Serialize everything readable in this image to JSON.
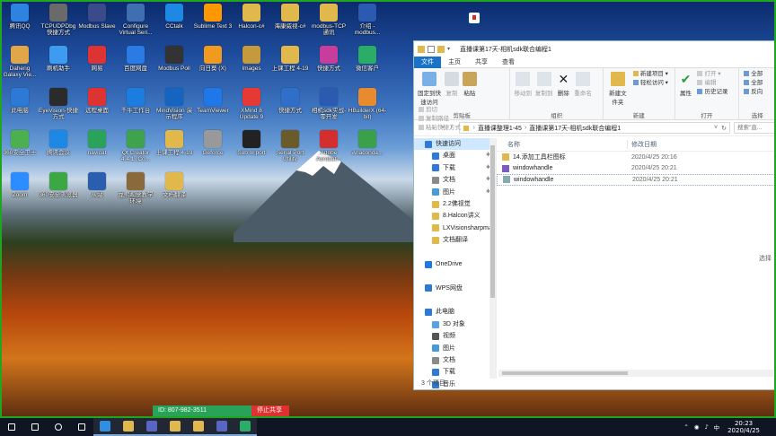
{
  "desktop_icons": [
    {
      "label": "腾讯QQ",
      "color": "#2f83e0"
    },
    {
      "label": "TCPUDPDbg 快捷方式",
      "color": "#6a6a6a"
    },
    {
      "label": "Modbus Slave",
      "color": "#3b4a8a"
    },
    {
      "label": "Configure Virtual Seri...",
      "color": "#3f6fb0"
    },
    {
      "label": "CCtalk",
      "color": "#1e88e5"
    },
    {
      "label": "Sublime Text 3",
      "color": "#ff9800"
    },
    {
      "label": "Halcon-c#",
      "color": "#e0b84b"
    },
    {
      "label": "海康威视-c#",
      "color": "#e0b84b"
    },
    {
      "label": "modbus-TCP 通讯",
      "color": "#e0b84b"
    },
    {
      "label": "介绍 -modbus...",
      "color": "#2b5bb0"
    },
    {
      "label": "Daheng Galaxy Vie...",
      "color": "#e2a64a"
    },
    {
      "label": "刷机助手",
      "color": "#3d9cf0"
    },
    {
      "label": "网易",
      "color": "#d33"
    },
    {
      "label": "百度网盘",
      "color": "#2a7be4"
    },
    {
      "label": "Modbus Poll",
      "color": "#333"
    },
    {
      "label": "向日葵 (X)",
      "color": "#f29a1f"
    },
    {
      "label": "Images",
      "color": "#c59a3c"
    },
    {
      "label": "上课工程 4-19",
      "color": "#e0b84b"
    },
    {
      "label": "快捷方式",
      "color": "#c63d9b"
    },
    {
      "label": "微信客户",
      "color": "#2aae67"
    },
    {
      "label": "此电脑",
      "color": "#2d7ad6"
    },
    {
      "label": "EyeVision-快捷方式",
      "color": "#2b2b2b"
    },
    {
      "label": "远程桌面",
      "color": "#d33"
    },
    {
      "label": "千牛工作台",
      "color": "#1b7de0"
    },
    {
      "label": "MindVision 演示程序",
      "color": "#1565c0"
    },
    {
      "label": "TeamViewer",
      "color": "#1e78e8"
    },
    {
      "label": "XMind 8 Update 9",
      "color": "#e53935"
    },
    {
      "label": "快捷方式",
      "color": "#2f6ec9"
    },
    {
      "label": "相机sdk实战-零开发",
      "color": "#2b5bb0"
    },
    {
      "label": "HBuilderX (64-bit)",
      "color": "#e88a2e"
    },
    {
      "label": "360安全卫士",
      "color": "#4caf50"
    },
    {
      "label": "腾讯会议",
      "color": "#1e88e5"
    },
    {
      "label": "navicat",
      "color": "#29a35a"
    },
    {
      "label": "Qt Creator 4.4.1 (Co...",
      "color": "#3fa34d"
    },
    {
      "label": "上课工程 4-19",
      "color": "#e0b84b"
    },
    {
      "label": "Geforce",
      "color": "#999"
    },
    {
      "label": "Sub ol port",
      "color": "#222"
    },
    {
      "label": "Serial Port Utility",
      "color": "#6b5a2a"
    },
    {
      "label": "Adobe Acrobat...",
      "color": "#d32f2f"
    },
    {
      "label": "Anaconda...",
      "color": "#3aa04a"
    },
    {
      "label": "Zoom",
      "color": "#2d8cff"
    },
    {
      "label": "360安全浏览器",
      "color": "#3ca843"
    },
    {
      "label": "从站",
      "color": "#2a5fb0"
    },
    {
      "label": "龙熙视觉教学环境",
      "color": "#8a6a3a"
    },
    {
      "label": "文档翻译",
      "color": "#e0b84b"
    }
  ],
  "explorer": {
    "title": "直播课第17天-相机sdk联合编程1",
    "tabs": [
      "文件",
      "主页",
      "共享",
      "查看"
    ],
    "ribbon": {
      "clipboard": {
        "label": "剪贴板",
        "pin": "固定到快速访问",
        "copy": "复制",
        "paste": "粘贴",
        "cut": "剪切",
        "copy_path": "复制路径",
        "paste_shortcut": "粘贴快捷方式"
      },
      "organize": {
        "label": "组织",
        "move_to": "移动到",
        "copy_to": "复制到",
        "delete": "删除",
        "rename": "重命名"
      },
      "new": {
        "label": "新建",
        "new_folder": "新建文件夹",
        "new_item": "新建项目",
        "easy_access": "轻松访问"
      },
      "open": {
        "label": "打开",
        "properties": "属性",
        "open": "打开",
        "edit": "编辑",
        "history": "历史记录"
      },
      "select": {
        "label": "选择",
        "all": "全部",
        "none": "全部",
        "invert": "反向"
      }
    },
    "address": {
      "parts": [
        "直播课整理1-45",
        "直播课第17天-相机sdk联合编程1"
      ],
      "search_placeholder": "搜索\"直..."
    },
    "nav_items": [
      {
        "label": "快速访问",
        "color": "#2f7ad6",
        "pinned": false,
        "selected": true
      },
      {
        "label": "桌面",
        "color": "#2f7ad6",
        "pinned": true
      },
      {
        "label": "下载",
        "color": "#2f7ad6",
        "pinned": true
      },
      {
        "label": "文档",
        "color": "#8a8a8a",
        "pinned": true
      },
      {
        "label": "图片",
        "color": "#4a9ad6",
        "pinned": true
      },
      {
        "label": "2.2佛视觉",
        "color": "#e0b84b",
        "pinned": false
      },
      {
        "label": "8.Halcon讲义",
        "color": "#e0b84b",
        "pinned": false
      },
      {
        "label": "LXVisionsharpma",
        "color": "#e0b84b",
        "pinned": false
      },
      {
        "label": "文档翻译",
        "color": "#e0b84b",
        "pinned": false
      },
      {
        "label": "",
        "color": "transparent",
        "pinned": false
      },
      {
        "label": "OneDrive",
        "color": "#1e78e8",
        "pinned": false
      },
      {
        "label": "",
        "color": "transparent",
        "pinned": false
      },
      {
        "label": "WPS网盘",
        "color": "#2d7ad6",
        "pinned": false
      },
      {
        "label": "",
        "color": "transparent",
        "pinned": false
      },
      {
        "label": "此电脑",
        "color": "#2d7ad6",
        "pinned": false
      },
      {
        "label": "3D 对象",
        "color": "#5aa3e0",
        "pinned": false
      },
      {
        "label": "视频",
        "color": "#555",
        "pinned": false
      },
      {
        "label": "图片",
        "color": "#4a9ad6",
        "pinned": false
      },
      {
        "label": "文档",
        "color": "#8a8a8a",
        "pinned": false
      },
      {
        "label": "下载",
        "color": "#2f7ad6",
        "pinned": false
      },
      {
        "label": "音乐",
        "color": "#2f7ad6",
        "pinned": false
      }
    ],
    "columns": [
      "名称",
      "修改日期"
    ],
    "files": [
      {
        "name": "14.添加工具栏图标",
        "date": "2020/4/25 20:16",
        "type": "folder"
      },
      {
        "name": "windowhandle",
        "date": "2020/4/25 20:21",
        "type": "sln"
      },
      {
        "name": "windowhandle",
        "date": "2020/4/25 20:21",
        "type": "file"
      }
    ],
    "status": "3 个项目",
    "preview_text": "选择"
  },
  "remote": {
    "id_text": "ID: 807-982-3511",
    "stop_text": "停止共享"
  },
  "taskbar": {
    "apps": [
      {
        "name": "start-icon",
        "color": "#ffffff"
      },
      {
        "name": "search-icon",
        "color": "#ffffff"
      },
      {
        "name": "cortana-icon",
        "color": "#ffffff"
      },
      {
        "name": "task-view-icon",
        "color": "#ffffff"
      },
      {
        "name": "edge-icon",
        "color": "#2f8fe0"
      },
      {
        "name": "explorer-icon",
        "color": "#e0b84b"
      },
      {
        "name": "teams-icon",
        "color": "#5a66c5"
      },
      {
        "name": "chrome-icon",
        "color": "#e0b84b"
      },
      {
        "name": "folder-icon",
        "color": "#e0b84b"
      },
      {
        "name": "vs-icon",
        "color": "#5a66c5"
      },
      {
        "name": "wechat-icon",
        "color": "#2aae67"
      }
    ],
    "tray": {
      "ime": "中",
      "time": "20:23",
      "date": "2020/4/25"
    }
  }
}
